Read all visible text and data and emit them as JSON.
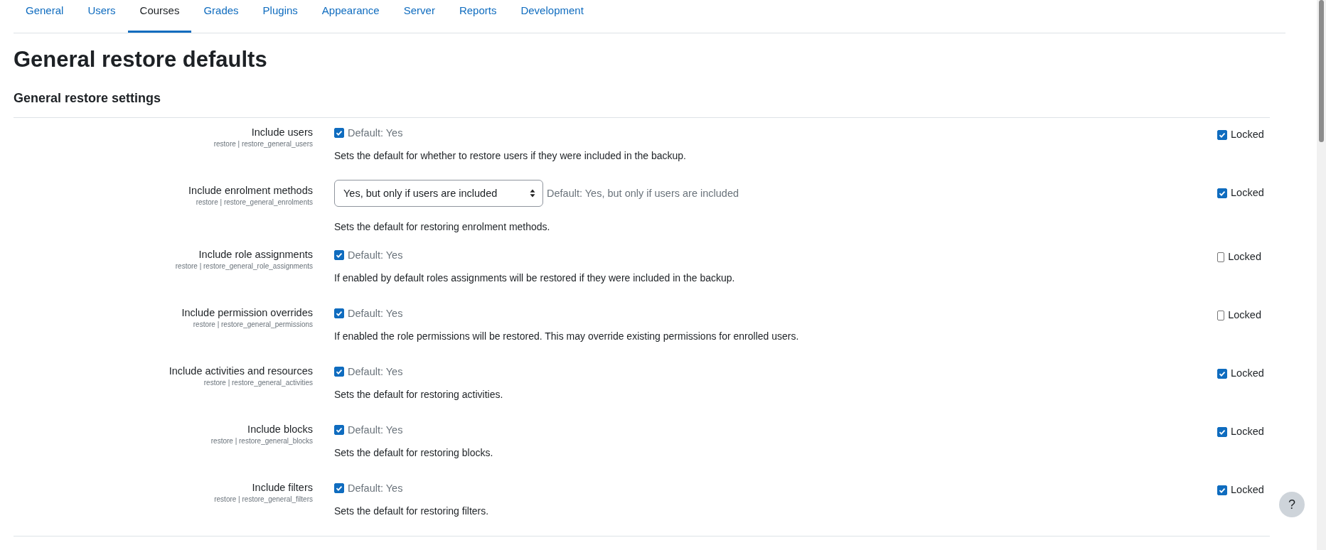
{
  "tabs": [
    {
      "label": "General",
      "selected": false
    },
    {
      "label": "Users",
      "selected": false
    },
    {
      "label": "Courses",
      "selected": true
    },
    {
      "label": "Grades",
      "selected": false
    },
    {
      "label": "Plugins",
      "selected": false
    },
    {
      "label": "Appearance",
      "selected": false
    },
    {
      "label": "Server",
      "selected": false
    },
    {
      "label": "Reports",
      "selected": false
    },
    {
      "label": "Development",
      "selected": false
    }
  ],
  "title": "General restore defaults",
  "section_title": "General restore settings",
  "settings": [
    {
      "kind": "checkbox",
      "label": "Include users",
      "key": "restore | restore_general_users",
      "checked": true,
      "default": "Default: Yes",
      "description": "Sets the default for whether to restore users if they were included in the backup.",
      "locked_label": "Locked",
      "locked": true
    },
    {
      "kind": "select",
      "label": "Include enrolment methods",
      "key": "restore | restore_general_enrolments",
      "value": "Yes, but only if users are included",
      "default": "Default: Yes, but only if users are included",
      "description": "Sets the default for restoring enrolment methods.",
      "locked_label": "Locked",
      "locked": true
    },
    {
      "kind": "checkbox",
      "label": "Include role assignments",
      "key": "restore | restore_general_role_assignments",
      "checked": true,
      "default": "Default: Yes",
      "description": "If enabled by default roles assignments will be restored if they were included in the backup.",
      "locked_label": "Locked",
      "locked": false
    },
    {
      "kind": "checkbox",
      "label": "Include permission overrides",
      "key": "restore | restore_general_permissions",
      "checked": true,
      "default": "Default: Yes",
      "description": "If enabled the role permissions will be restored. This may override existing permissions for enrolled users.",
      "locked_label": "Locked",
      "locked": false
    },
    {
      "kind": "checkbox",
      "label": "Include activities and resources",
      "key": "restore | restore_general_activities",
      "checked": true,
      "default": "Default: Yes",
      "description": "Sets the default for restoring activities.",
      "locked_label": "Locked",
      "locked": true
    },
    {
      "kind": "checkbox",
      "label": "Include blocks",
      "key": "restore | restore_general_blocks",
      "checked": true,
      "default": "Default: Yes",
      "description": "Sets the default for restoring blocks.",
      "locked_label": "Locked",
      "locked": true
    },
    {
      "kind": "checkbox",
      "label": "Include filters",
      "key": "restore | restore_general_filters",
      "checked": true,
      "default": "Default: Yes",
      "description": "Sets the default for restoring filters.",
      "locked_label": "Locked",
      "locked": true
    }
  ],
  "help_button": "?"
}
